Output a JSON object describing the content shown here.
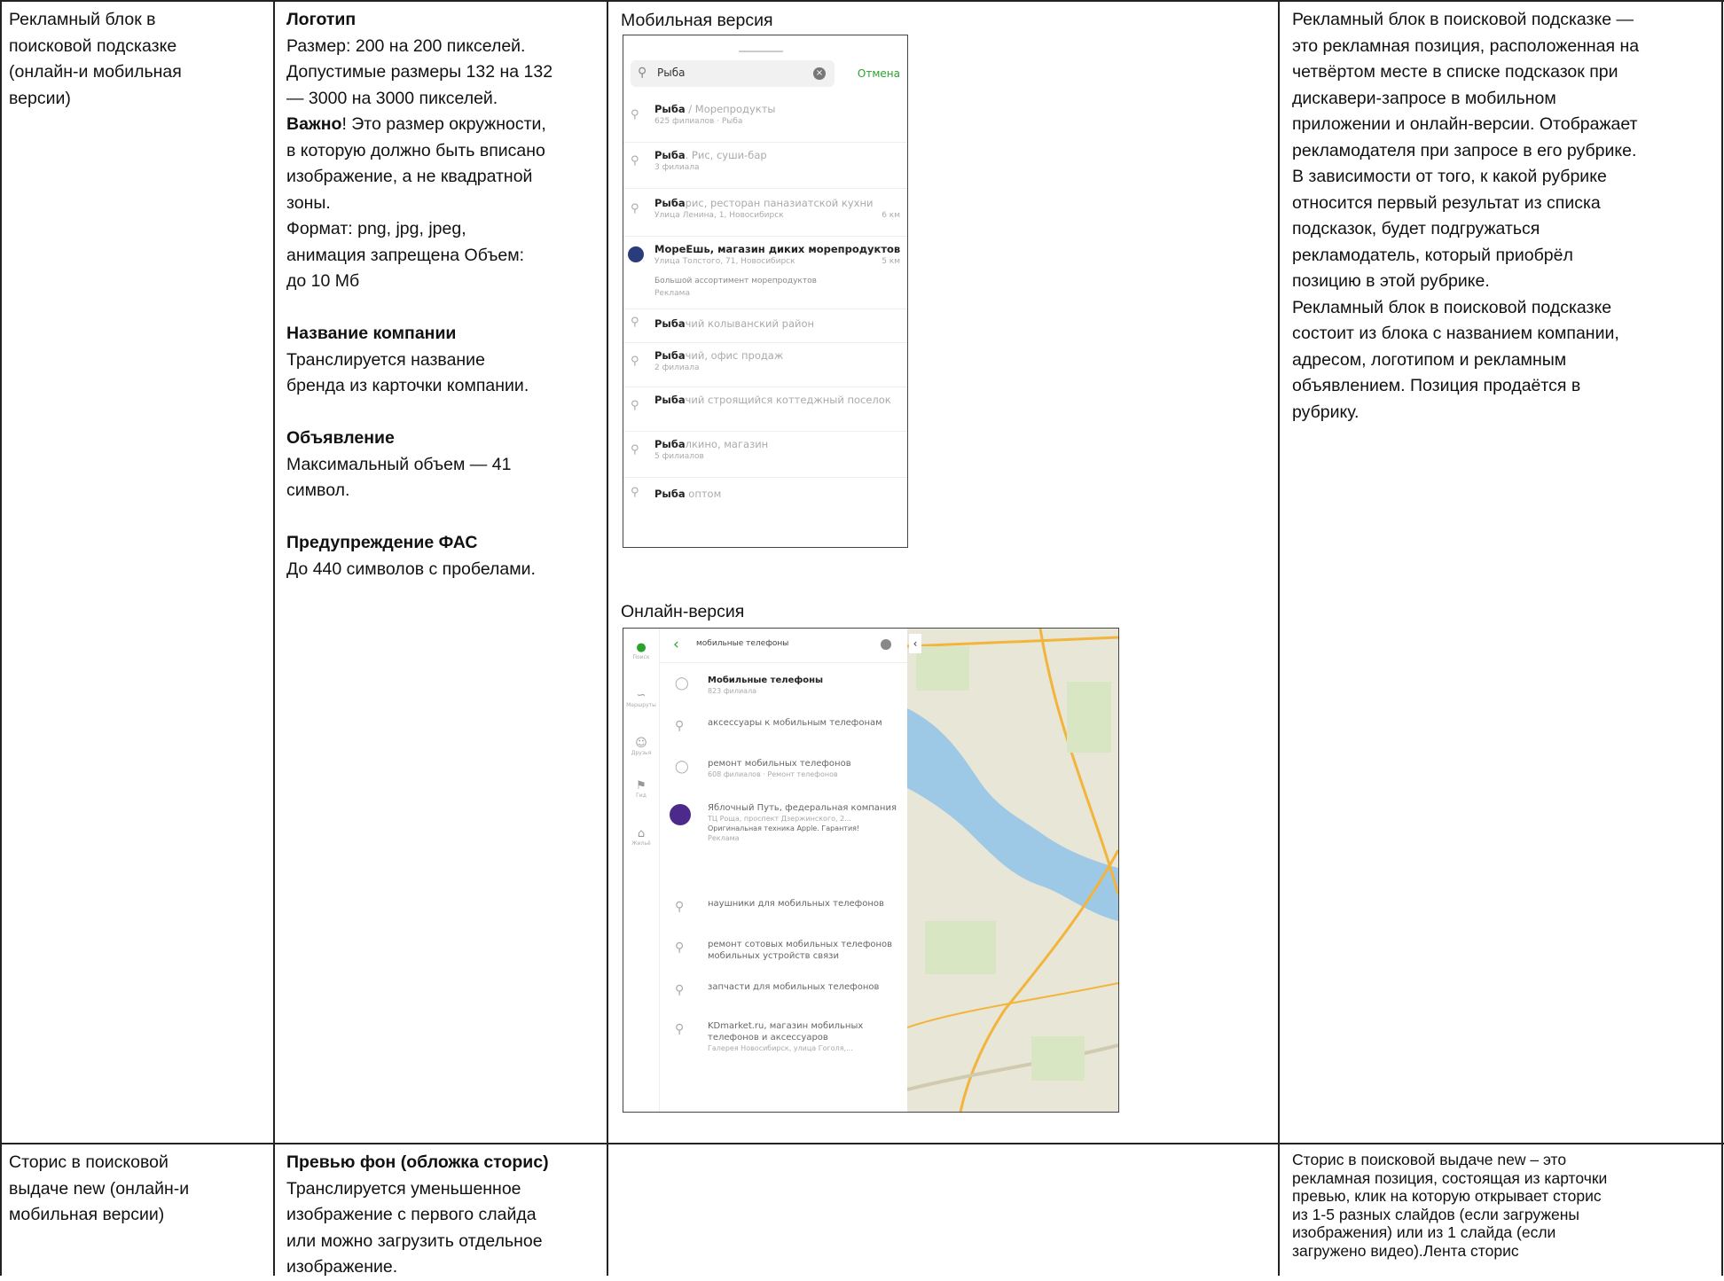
{
  "row1": {
    "col1": [
      "Рекламный блок в",
      "поисковой подсказке",
      "(онлайн-и мобильная",
      "версии)"
    ],
    "col2": {
      "logo_title": "Логотип",
      "logo_lines": [
        "Размер: 200 на 200 пикселей.",
        "Допустимые размеры 132 на 132",
        "— 3000 на 3000 пикселей."
      ],
      "important_bold": "Важно",
      "important_rest": "! Это размер окружности,",
      "important_lines": [
        "в которую должно быть вписано",
        "изображение, а не квадратной",
        "зоны."
      ],
      "format_lines": [
        "Формат: png, jpg, jpeg,",
        "анимация запрещена Объем:",
        "до 10 Мб"
      ],
      "company_title": "Название компании",
      "company_lines": [
        "Транслируется название",
        "бренда из карточки компании."
      ],
      "ad_title": "Объявление",
      "ad_lines": [
        "Максимальный объем — 41",
        "символ."
      ],
      "fas_title": "Предупреждение ФАС",
      "fas_lines": [
        "До 440 символов с пробелами."
      ]
    },
    "col3": {
      "mobile_label": "Мобильная версия",
      "online_label": "Онлайн-версия"
    },
    "col4": [
      "Рекламный блок в поисковой подсказке —",
      "это рекламная позиция, расположенная на",
      "четвёртом месте в списке подсказок при",
      "дискавери-запросе в мобильном",
      "приложении и онлайн-версии. Отображает",
      "рекламодателя при запросе в его рубрике.",
      "В зависимости от того, к какой рубрике",
      "относится первый результат из списка",
      "подсказок, будет подгружаться",
      "рекламодатель, который приобрёл",
      "позицию в этой рубрике.",
      "Рекламный блок в поисковой подсказке",
      "состоит из блока с названием компании,",
      "адресом, логотипом и рекламным",
      "объявлением. Позиция продаётся в",
      "рубрику."
    ]
  },
  "row2": {
    "col1": [
      "Сторис в поисковой",
      "выдаче new (онлайн-и",
      "мобильная версии)"
    ],
    "col2_title": "Превью фон (обложка сторис)",
    "col2": [
      "Транслируется уменьшенное",
      "изображение с первого слайда",
      "или можно загрузить отдельное",
      "изображение."
    ],
    "col4": [
      "Сторис в поисковой выдаче new – это",
      "рекламная позиция, состоящая из карточки",
      "превью, клик на которую открывает сторис",
      "из 1-5 разных слайдов (если загружены",
      "изображения) или из 1 слайда (если",
      "загружено видео).Лента сторис"
    ]
  },
  "mobile_mock": {
    "query": "Рыба",
    "cancel": "Отмена",
    "rows": [
      {
        "bold": "Рыба",
        "rest": " / Морепродукты",
        "sub": "625 филиалов · Рыба",
        "dist": ""
      },
      {
        "bold": "Рыба",
        "rest": ". Рис, суши-бар",
        "sub": "3 филиала",
        "dist": ""
      },
      {
        "bold": "Рыба",
        "rest": "рис, ресторан паназиатской кухни",
        "sub": "Улица Ленина, 1, Новосибирск",
        "dist": "6 км"
      },
      {
        "bold": "МореЕшь, магазин диких морепродуктов",
        "rest": "",
        "sub": "Улица Толстого, 71, Новосибирск",
        "dist": "5 км",
        "ad": "Большой ассортимент морепродуктов",
        "ad_tag": "Реклама"
      },
      {
        "bold": "Рыба",
        "rest": "чий колыванский район",
        "sub": "",
        "dist": ""
      },
      {
        "bold": "Рыба",
        "rest": "чий, офис продаж",
        "sub": "2 филиала",
        "dist": ""
      },
      {
        "bold": "Рыба",
        "rest": "чий строящийся коттеджный поселок",
        "sub": "",
        "dist": ""
      },
      {
        "bold": "Рыба",
        "rest": "лкино, магазин",
        "sub": "5 филиалов",
        "dist": ""
      },
      {
        "bold": "Рыба",
        "rest": " оптом",
        "sub": "",
        "dist": ""
      }
    ]
  },
  "desktop_mock": {
    "query": "мобильные телефоны",
    "rail": [
      "Поиск",
      "Маршруты",
      "Друзья",
      "Гид",
      "Жильё"
    ],
    "rows": [
      {
        "text": "Мобильные телефоны",
        "sub": "823 филиала"
      },
      {
        "text": "аксессуары к мобильным телефонам",
        "sub": ""
      },
      {
        "text": "ремонт мобильных телефонов",
        "sub": "608 филиалов · Ремонт телефонов"
      },
      {
        "text": "Яблочный Путь, федеральная компания",
        "sub": "ТЦ Роща, проспект Дзержинского, 2...",
        "ad": "Оригинальная техника Apple. Гарантия!",
        "ad_tag": "Реклама"
      },
      {
        "text": "наушники для мобильных телефонов",
        "sub": ""
      },
      {
        "text": "ремонт сотовых мобильных телефонов мобильных устройств связи",
        "sub": ""
      },
      {
        "text": "запчасти для мобильных телефонов",
        "sub": ""
      },
      {
        "text": "KDmarket.ru, магазин мобильных телефонов и аксессуаров",
        "sub": "Галерея Новосибирск, улица Гоголя,..."
      }
    ]
  }
}
